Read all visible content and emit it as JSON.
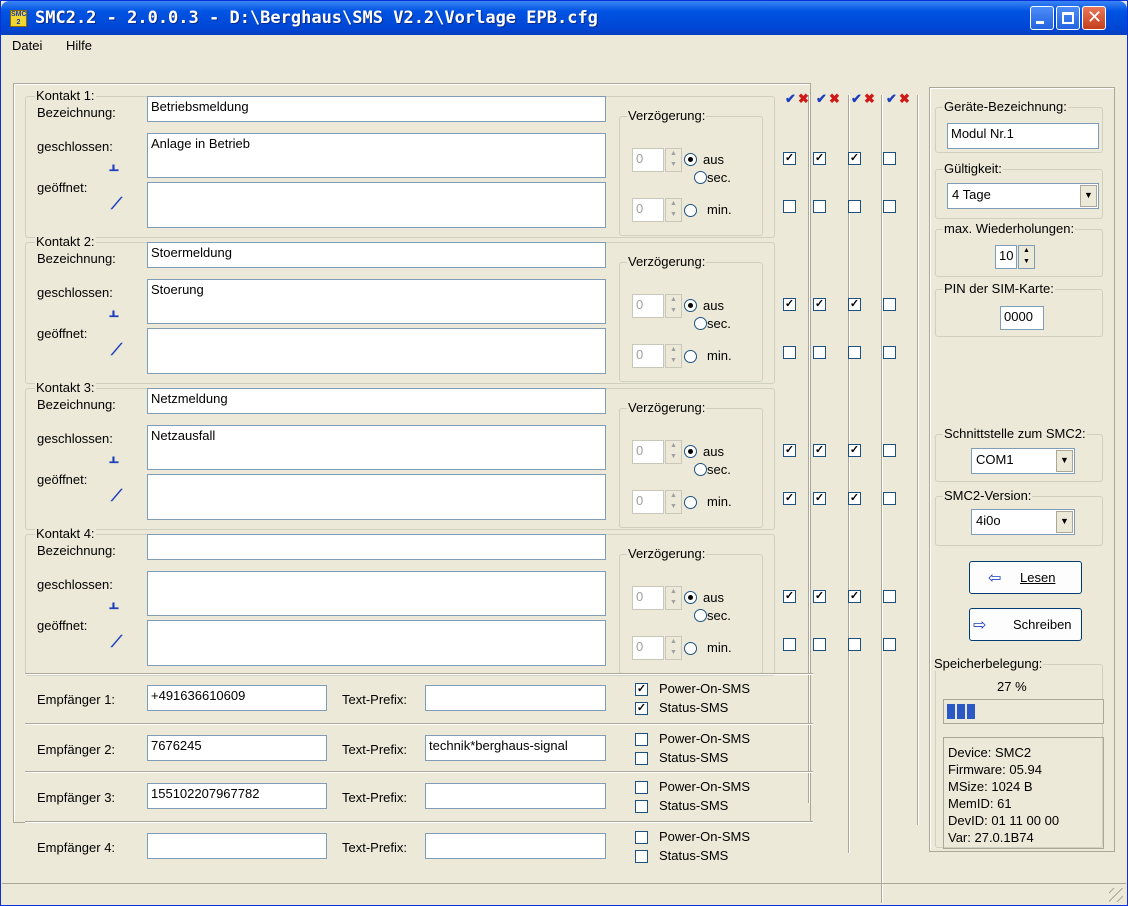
{
  "window": {
    "title": "SMC2.2 - 2.0.0.3 - D:\\Berghaus\\SMS V2.2\\Vorlage EPB.cfg",
    "icon_text": "SMC\n2"
  },
  "menu": {
    "file": "Datei",
    "help": "Hilfe"
  },
  "labels": {
    "bezeichnung": "Bezeichnung:",
    "geschlossen": "geschlossen:",
    "geoeffnet": "geöffnet:",
    "verzoegerung": "Verzögerung:",
    "aus": "aus",
    "sec": "sec.",
    "min": "min.",
    "text_prefix": "Text-Prefix:",
    "power_on_sms": "Power-On-SMS",
    "status_sms": "Status-SMS"
  },
  "contacts": [
    {
      "title": "Kontakt 1:",
      "bezeichnung": "Betriebsmeldung",
      "geschlossen": "Anlage in Betrieb",
      "geoeffnet": "",
      "delay1": "0",
      "delay2": "0",
      "closed_checks": [
        true,
        true,
        true,
        false
      ],
      "open_checks": [
        false,
        false,
        false,
        false
      ]
    },
    {
      "title": "Kontakt 2:",
      "bezeichnung": "Stoermeldung",
      "geschlossen": "Stoerung",
      "geoeffnet": "",
      "delay1": "0",
      "delay2": "0",
      "closed_checks": [
        true,
        true,
        true,
        false
      ],
      "open_checks": [
        false,
        false,
        false,
        false
      ]
    },
    {
      "title": "Kontakt 3:",
      "bezeichnung": "Netzmeldung",
      "geschlossen": "Netzausfall",
      "geoeffnet": "",
      "delay1": "0",
      "delay2": "0",
      "closed_checks": [
        true,
        true,
        true,
        false
      ],
      "open_checks": [
        true,
        true,
        true,
        false
      ]
    },
    {
      "title": "Kontakt 4:",
      "bezeichnung": "",
      "geschlossen": "",
      "geoeffnet": "",
      "delay1": "0",
      "delay2": "0",
      "closed_checks": [
        true,
        true,
        true,
        false
      ],
      "open_checks": [
        false,
        false,
        false,
        false
      ]
    }
  ],
  "recipients": [
    {
      "label": "Empfänger 1:",
      "number": "+491636610609",
      "prefix": "",
      "power_on": true,
      "status": true
    },
    {
      "label": "Empfänger 2:",
      "number": "7676245",
      "prefix": "technik*berghaus-signal",
      "power_on": false,
      "status": false
    },
    {
      "label": "Empfänger 3:",
      "number": "155102207967782",
      "prefix": "",
      "power_on": false,
      "status": false
    },
    {
      "label": "Empfänger 4:",
      "number": "",
      "prefix": "",
      "power_on": false,
      "status": false
    }
  ],
  "column_header_icons": [
    "checkmark-icon",
    "cross-icon",
    "checkmark-icon",
    "cross-icon",
    "checkmark-icon",
    "cross-icon",
    "checkmark-icon",
    "cross-icon"
  ],
  "side": {
    "device_name_label": "Geräte-Bezeichnung:",
    "device_name": "Modul Nr.1",
    "validity_label": "Gültigkeit:",
    "validity": "4 Tage",
    "max_repeat_label": "max. Wiederholungen:",
    "max_repeat": "10",
    "pin_label": "PIN der SIM-Karte:",
    "pin": "0000",
    "interface_label": "Schnittstelle zum SMC2:",
    "interface": "COM1",
    "version_label": "SMC2-Version:",
    "version": "4i0o",
    "read_button": "Lesen",
    "write_button": "Schreiben",
    "memory_label": "Speicherbelegung:",
    "memory_percent": "27 %",
    "memory_fraction": 0.27,
    "device_info": [
      "Device: SMC2",
      "Firmware: 05.94",
      "MSize: 1024 B",
      "MemID: 61",
      "DevID: 01 11 00 00",
      "Var: 27.0.1B74"
    ]
  }
}
